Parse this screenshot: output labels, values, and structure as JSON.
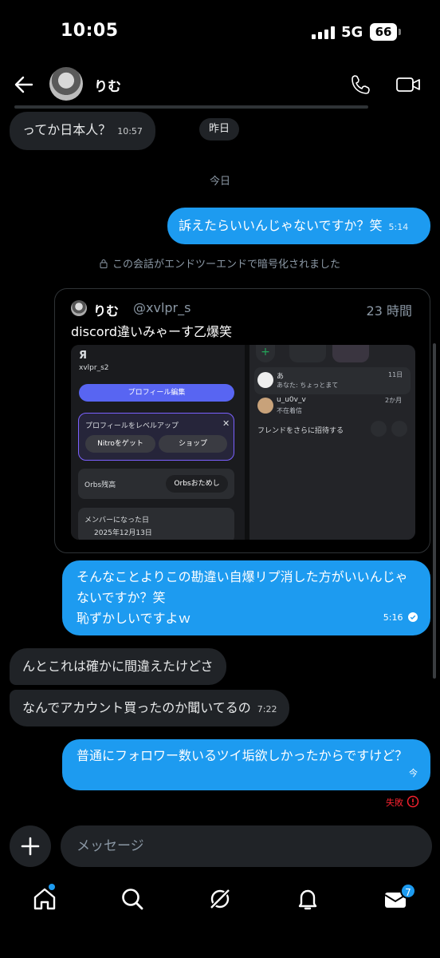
{
  "status_bar": {
    "time": "10:05",
    "network": "5G",
    "battery": "66"
  },
  "header": {
    "name": "りむ"
  },
  "messages": {
    "m1": {
      "text": "ってか日本人？",
      "time": "10:57"
    },
    "yesterday": "昨日",
    "today": "今日",
    "m2": {
      "text": "訴えたらいいんじゃないですか？笑",
      "time": "5:14"
    },
    "encryption": "この会話がエンドツーエンドで暗号化されました",
    "card": {
      "name": "りむ",
      "handle": "@xvlpr_s",
      "time": "23 時間",
      "text": "discord違いみゃーす乙爆笑",
      "screenshot": {
        "logo": "Я",
        "username": "xvlpr_s2",
        "edit_profile": "プロフィール編集",
        "level_up": "プロフィールをレベルアップ",
        "nitro": "Nitroをゲット",
        "shop": "ショップ",
        "orbs_balance": "Orbs残高",
        "orbs_try": "Orbsおためし",
        "member_since_label": "メンバーになった日",
        "member_since": "2025年12月13日",
        "dm1_name": "あ",
        "dm1_preview": "あなた: ちょっとまて",
        "dm1_time": "11日",
        "dm2_name": "u_u0v_v",
        "dm2_status": "不在着信",
        "dm2_time": "2か月",
        "invite": "フレンドをさらに招待する"
      }
    },
    "m3": {
      "line1": "そんなことよりこの勘違い自爆リプ消した方がいいんじゃ",
      "line2": "ないですか？笑",
      "line3": "恥ずかしいですよｗ",
      "time": "5:16"
    },
    "m4": {
      "text": "んとこれは確かに間違えたけどさ"
    },
    "m5": {
      "text": "なんでアカウント買ったのか聞いてるの",
      "time": "7:22"
    },
    "m6": {
      "text": "普通にフォロワー数いるツイ垢欲しかったからですけど？",
      "time": "今",
      "status": "失敗"
    }
  },
  "composer": {
    "placeholder": "メッセージ"
  },
  "nav": {
    "messages_badge": "7"
  },
  "colors": {
    "accent": "#1d9bf0",
    "bubble_in": "#202327",
    "error": "#f4212e"
  }
}
